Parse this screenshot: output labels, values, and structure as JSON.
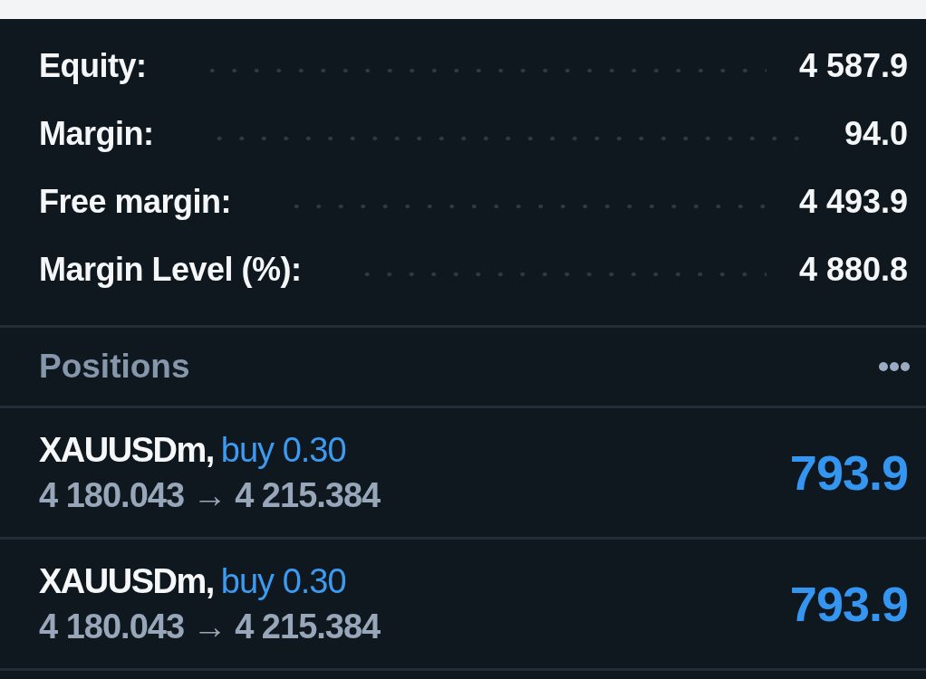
{
  "account": [
    {
      "label": "Equity:",
      "value": "4 587.9"
    },
    {
      "label": "Margin:",
      "value": "94.0"
    },
    {
      "label": "Free margin:",
      "value": "4 493.9"
    },
    {
      "label": "Margin Level (%):",
      "value": "4 880.8"
    }
  ],
  "positions": {
    "title": "Positions",
    "items": [
      {
        "symbol": "XAUUSDm,",
        "side": "buy 0.30",
        "prices": "4 180.043 → 4 215.384",
        "profit": "793.9"
      },
      {
        "symbol": "XAUUSDm,",
        "side": "buy 0.30",
        "prices": "4 180.043 → 4 215.384",
        "profit": "793.9"
      }
    ]
  }
}
